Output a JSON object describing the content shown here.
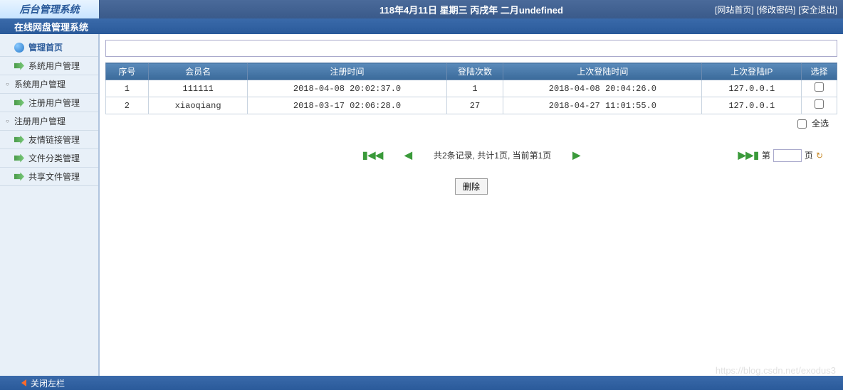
{
  "header": {
    "logo": "后台管理系统",
    "date_text": "118年4月11日 星期三 丙戌年 二月undefined",
    "links": {
      "home": "[网站首页]",
      "pwd": "[修改密码]",
      "logout": "[安全退出]"
    }
  },
  "subheader": {
    "title": "在线网盘管理系统"
  },
  "sidebar": {
    "items": [
      {
        "label": "管理首页",
        "type": "home"
      },
      {
        "label": "系统用户管理",
        "type": "arrow"
      },
      {
        "label": "系统用户管理",
        "type": "bullet"
      },
      {
        "label": "注册用户管理",
        "type": "arrow"
      },
      {
        "label": "注册用户管理",
        "type": "bullet"
      },
      {
        "label": "友情链接管理",
        "type": "arrow"
      },
      {
        "label": "文件分类管理",
        "type": "arrow"
      },
      {
        "label": "共享文件管理",
        "type": "arrow"
      }
    ]
  },
  "table": {
    "headers": [
      "序号",
      "会员名",
      "注册时间",
      "登陆次数",
      "上次登陆时间",
      "上次登陆IP",
      "选择"
    ],
    "rows": [
      {
        "idx": "1",
        "name": "111111",
        "reg": "2018-04-08 20:02:37.0",
        "count": "1",
        "last_time": "2018-04-08 20:04:26.0",
        "ip": "127.0.0.1"
      },
      {
        "idx": "2",
        "name": "xiaoqiang",
        "reg": "2018-03-17 02:06:28.0",
        "count": "27",
        "last_time": "2018-04-27 11:01:55.0",
        "ip": "127.0.0.1"
      }
    ],
    "select_all": "全选"
  },
  "pager": {
    "info": "共2条记录, 共计1页, 当前第1页",
    "page_prefix": "第",
    "page_suffix": "页"
  },
  "actions": {
    "delete": "删除"
  },
  "footer": {
    "close": "关闭左栏"
  },
  "watermark": "https://blog.csdn.net/exodus3"
}
